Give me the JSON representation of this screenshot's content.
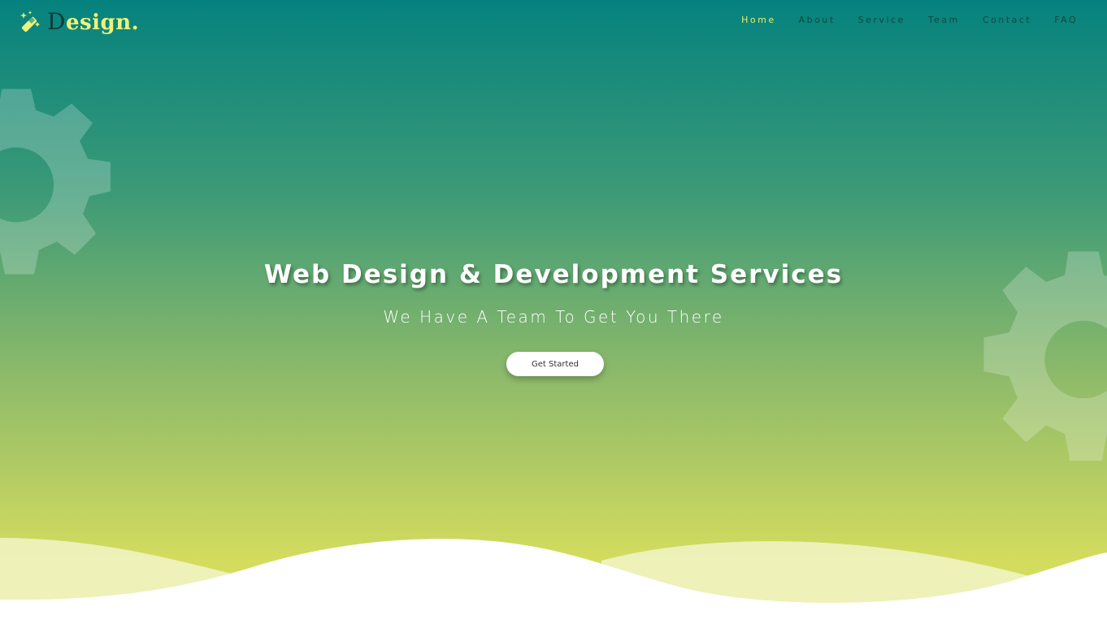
{
  "brand": {
    "logo_first_letter": "D",
    "logo_rest": "esign.",
    "logo_icon": "magic-wand-icon",
    "accent_color": "#e6ef6a"
  },
  "nav": {
    "items": [
      {
        "label": "Home",
        "active": true
      },
      {
        "label": "About",
        "active": false
      },
      {
        "label": "Service",
        "active": false
      },
      {
        "label": "Team",
        "active": false
      },
      {
        "label": "Contact",
        "active": false
      },
      {
        "label": "FAQ",
        "active": false
      }
    ]
  },
  "hero": {
    "title": "Web Design & Development Services",
    "subtitle": "We Have A Team To Get You There",
    "cta_label": "Get Started",
    "decor_icon": "gear-icon"
  },
  "colors": {
    "gradient_top": "#05827e",
    "gradient_bottom": "#d6dd5d",
    "wave": "#ffffff"
  }
}
